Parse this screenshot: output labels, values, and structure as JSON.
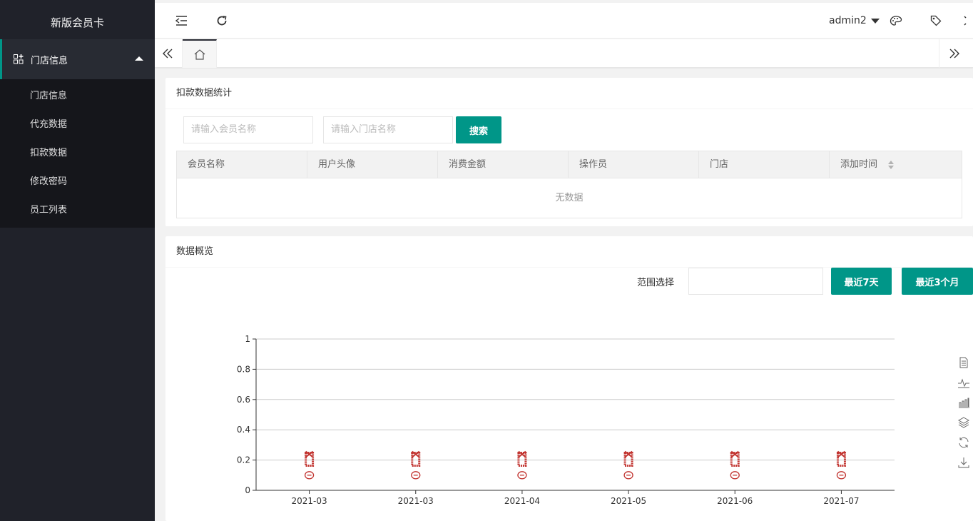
{
  "sidebar": {
    "title": "新版会员卡",
    "parent": {
      "label": "门店信息",
      "icon": "grid-icon"
    },
    "items": [
      {
        "label": "门店信息"
      },
      {
        "label": "代充数据"
      },
      {
        "label": "扣款数据"
      },
      {
        "label": "修改密码"
      },
      {
        "label": "员工列表"
      }
    ]
  },
  "header": {
    "username": "admin2",
    "icons": [
      "menu-fold-icon",
      "refresh-icon",
      "palette-icon",
      "tag-icon",
      "fullscreen-icon"
    ]
  },
  "tabs": {
    "home_icon": "home-icon"
  },
  "deduction": {
    "title": "扣款数据统计",
    "member_placeholder": "请输入会员名称",
    "store_placeholder": "请输入门店名称",
    "search_label": "搜索",
    "columns": [
      "会员名称",
      "用户头像",
      "消费金额",
      "操作员",
      "门店",
      "添加时间"
    ],
    "empty_text": "无数据"
  },
  "overview": {
    "title": "数据概览",
    "range_label": "范围选择",
    "btn_7days": "最近7天",
    "btn_3months": "最近3个月"
  },
  "colors": {
    "accent": "#009688",
    "sidebar": "#20222a",
    "series": "#c23531"
  },
  "chart_data": {
    "type": "line",
    "categories": [
      "2021-03",
      "2021-03",
      "2021-04",
      "2021-05",
      "2021-06",
      "2021-07"
    ],
    "ylim": [
      0,
      1
    ],
    "yticks": [
      "0",
      "0.2",
      "0.4",
      "0.6",
      "0.8",
      "1"
    ],
    "series": [
      {
        "values": [
          0.21,
          0.21,
          0.21,
          0.21,
          0.21,
          0.21
        ]
      },
      {
        "values": [
          0.1,
          0.1,
          0.1,
          0.1,
          0.1,
          0.1
        ]
      }
    ],
    "grid": true,
    "toolbox": [
      "data-view-icon",
      "line-chart-icon",
      "bar-chart-icon",
      "stack-icon",
      "restore-icon",
      "download-icon"
    ]
  }
}
